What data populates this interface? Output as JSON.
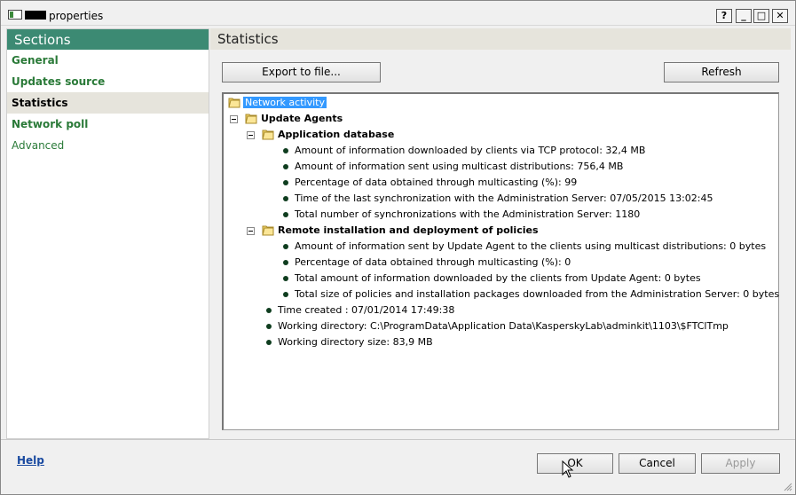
{
  "window": {
    "title": "properties",
    "help_button": "?",
    "minimize_button": "_",
    "maximize_button": "□",
    "close_button": "✕"
  },
  "sidebar": {
    "header": "Sections",
    "items": [
      {
        "label": "General"
      },
      {
        "label": "Updates source"
      },
      {
        "label": "Statistics"
      },
      {
        "label": "Network poll"
      },
      {
        "label": "Advanced"
      }
    ]
  },
  "main": {
    "title": "Statistics",
    "export_button": "Export to file...",
    "refresh_button": "Refresh",
    "tree": {
      "root": "Network activity",
      "update_agents": "Update Agents",
      "app_db": "Application database",
      "app_db_items": [
        "Amount of information downloaded by clients via TCP protocol: 32,4 MB",
        "Amount of information sent using multicast distributions: 756,4 MB",
        "Percentage of data obtained through multicasting (%): 99",
        "Time of the last synchronization with the Administration Server: 07/05/2015 13:02:45",
        "Total number of synchronizations with the Administration Server: 1180"
      ],
      "remote_install": "Remote installation and deployment of policies",
      "remote_install_items": [
        "Amount of information sent by Update Agent to the clients using multicast distributions: 0 bytes",
        "Percentage of data obtained through multicasting (%): 0",
        "Total amount of information downloaded by the clients from Update Agent: 0 bytes",
        "Total size of policies and installation packages downloaded from the Administration Server: 0 bytes"
      ],
      "agent_items": [
        "Time created : 07/01/2014 17:49:38",
        "Working directory: C:\\ProgramData\\Application Data\\KasperskyLab\\adminkit\\1103\\$FTClTmp",
        "Working directory size: 83,9 MB"
      ]
    }
  },
  "footer": {
    "help": "Help",
    "ok": "OK",
    "cancel": "Cancel",
    "apply": "Apply"
  },
  "colors": {
    "accent": "#3c8a73",
    "link_green": "#2a7a38",
    "selection": "#3399ff"
  }
}
